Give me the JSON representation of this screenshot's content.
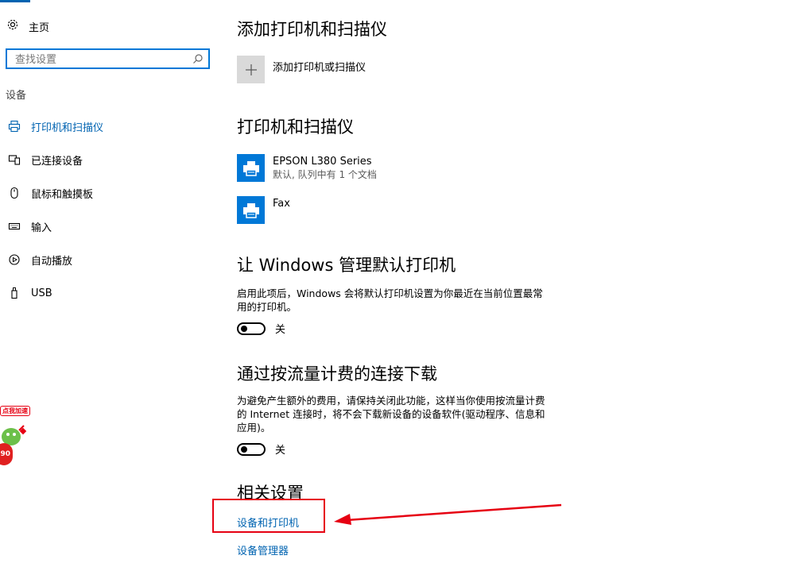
{
  "sidebar": {
    "home_label": "主页",
    "search": {
      "placeholder": "查找设置",
      "icon": "search-icon"
    },
    "group_label": "设备",
    "items": [
      {
        "label": "打印机和扫描仪",
        "icon": "printer-icon",
        "active": true
      },
      {
        "label": "已连接设备",
        "icon": "connected-devices-icon",
        "active": false
      },
      {
        "label": "鼠标和触摸板",
        "icon": "mouse-icon",
        "active": false
      },
      {
        "label": "输入",
        "icon": "keyboard-icon",
        "active": false
      },
      {
        "label": "自动播放",
        "icon": "autoplay-icon",
        "active": false
      },
      {
        "label": "USB",
        "icon": "usb-icon",
        "active": false
      }
    ]
  },
  "main": {
    "add_section": {
      "title": "添加打印机和扫描仪",
      "add_label": "添加打印机或扫描仪"
    },
    "printers_section": {
      "title": "打印机和扫描仪",
      "devices": [
        {
          "name": "EPSON L380 Series",
          "status": "默认, 队列中有 1 个文档"
        },
        {
          "name": "Fax",
          "status": ""
        }
      ]
    },
    "default_section": {
      "title": "让 Windows 管理默认打印机",
      "description": "启用此项后，Windows 会将默认打印机设置为你最近在当前位置最常用的打印机。",
      "toggle_label": "关",
      "toggle_on": false
    },
    "metered_section": {
      "title": "通过按流量计费的连接下载",
      "description": "为避免产生额外的费用，请保持关闭此功能，这样当你使用按流量计费的 Internet 连接时，将不会下载新设备的设备软件(驱动程序、信息和应用)。",
      "toggle_label": "关",
      "toggle_on": false
    },
    "related_section": {
      "title": "相关设置",
      "links": [
        "设备和打印机",
        "设备管理器"
      ]
    }
  },
  "overlay": {
    "widget_label": "点我加速",
    "widget_badge": "90"
  },
  "colors": {
    "accent": "#0063b1",
    "device_icon_bg": "#0078d7",
    "annotation": "#e60012"
  }
}
